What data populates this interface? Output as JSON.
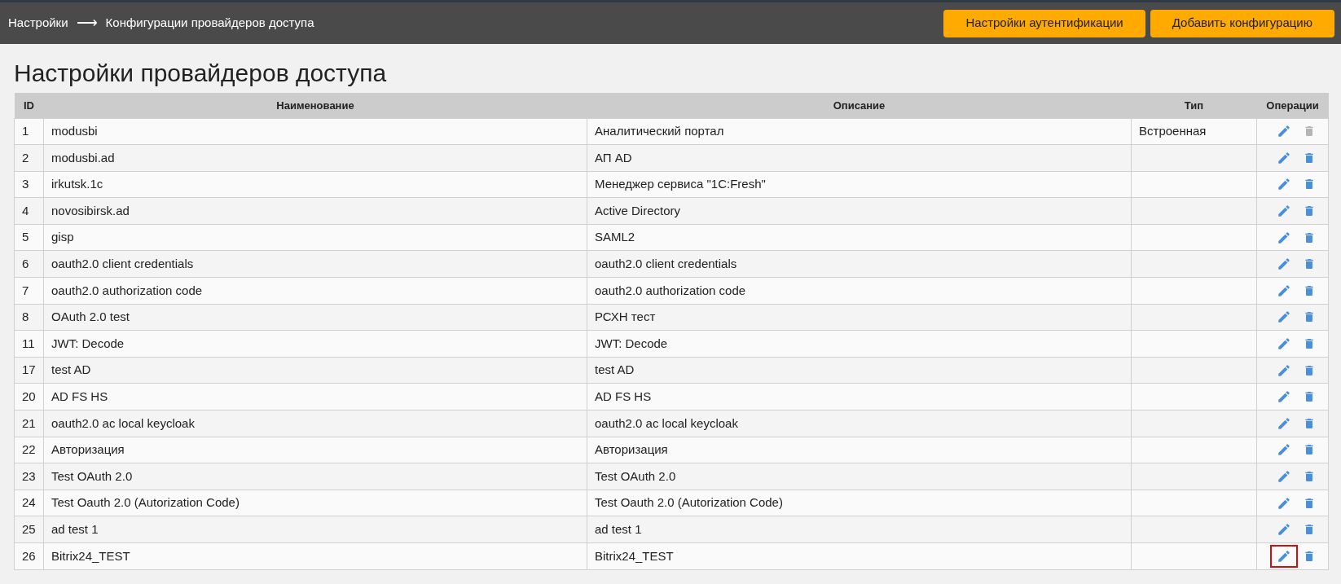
{
  "breadcrumb": {
    "items": [
      "Настройки",
      "Конфигурации провайдеров доступа"
    ],
    "separator": "⟶"
  },
  "header_buttons": [
    "Настройки аутентификации",
    "Добавить конфигурацию"
  ],
  "page_title": "Настройки провайдеров доступа",
  "table": {
    "columns": [
      "ID",
      "Наименование",
      "Описание",
      "Тип",
      "Операции"
    ],
    "rows": [
      {
        "id": "1",
        "name": "modusbi",
        "description": "Аналитический портал",
        "type": "Встроенная",
        "delete_disabled": true,
        "highlighted": false
      },
      {
        "id": "2",
        "name": "modusbi.ad",
        "description": "АП AD",
        "delete_disabled": false,
        "highlighted": false
      },
      {
        "id": "3",
        "name": "irkutsk.1c",
        "description": "Менеджер сервиса \"1C:Fresh\"",
        "delete_disabled": false,
        "highlighted": false
      },
      {
        "id": "4",
        "name": "novosibirsk.ad",
        "description": "Active Directory",
        "delete_disabled": false,
        "highlighted": false
      },
      {
        "id": "5",
        "name": "gisp",
        "description": "SAML2",
        "delete_disabled": false,
        "highlighted": false
      },
      {
        "id": "6",
        "name": "oauth2.0 client credentials",
        "description": "oauth2.0 client credentials",
        "delete_disabled": false,
        "highlighted": false
      },
      {
        "id": "7",
        "name": "oauth2.0 authorization code",
        "description": "oauth2.0 authorization code",
        "delete_disabled": false,
        "highlighted": false
      },
      {
        "id": "8",
        "name": "OAuth 2.0 test",
        "description": "РСХН тест",
        "delete_disabled": false,
        "highlighted": false
      },
      {
        "id": "11",
        "name": "JWT: Decode",
        "description": "JWT: Decode",
        "delete_disabled": false,
        "highlighted": false
      },
      {
        "id": "17",
        "name": "test AD",
        "description": "test AD",
        "delete_disabled": false,
        "highlighted": false
      },
      {
        "id": "20",
        "name": "AD FS HS",
        "description": "AD FS HS",
        "delete_disabled": false,
        "highlighted": false
      },
      {
        "id": "21",
        "name": "oauth2.0 ac local keycloak",
        "description": "oauth2.0 ac local keycloak",
        "delete_disabled": false,
        "highlighted": false
      },
      {
        "id": "22",
        "name": "Авторизация",
        "description": "Авторизация",
        "delete_disabled": false,
        "highlighted": false
      },
      {
        "id": "23",
        "name": "Test OAuth 2.0",
        "description": "Test OAuth 2.0",
        "delete_disabled": false,
        "highlighted": false
      },
      {
        "id": "24",
        "name": "Test Oauth 2.0 (Autorization Code)",
        "description": "Test Oauth 2.0 (Autorization Code)",
        "delete_disabled": false,
        "highlighted": false
      },
      {
        "id": "25",
        "name": "ad test 1",
        "description": "ad test 1",
        "delete_disabled": false,
        "highlighted": false
      },
      {
        "id": "26",
        "name": "Bitrix24_TEST",
        "description": "Bitrix24_TEST",
        "delete_disabled": false,
        "highlighted": true
      }
    ]
  }
}
